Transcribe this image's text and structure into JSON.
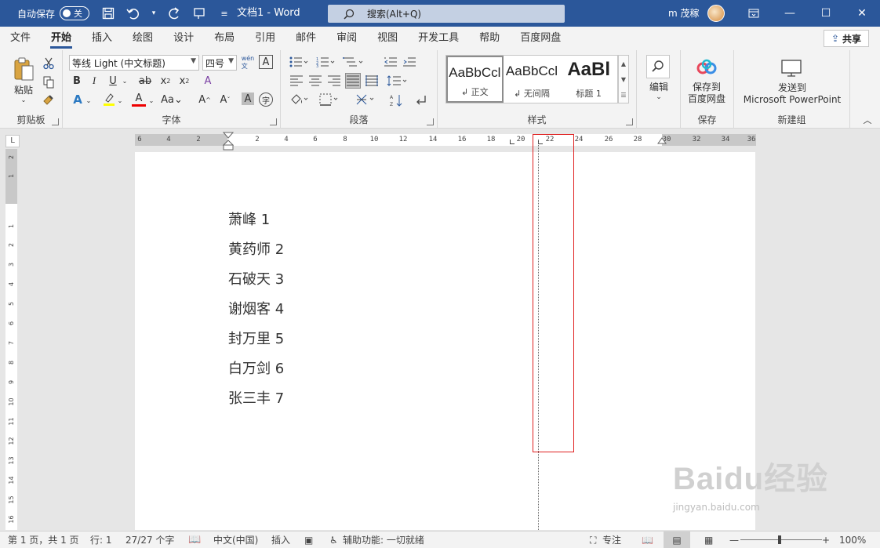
{
  "titlebar": {
    "autosave_label": "自动保存",
    "autosave_state": "关",
    "doc_title": "文档1  -  Word",
    "search_placeholder": "搜索(Alt+Q)",
    "user_name": "m 茂稼",
    "qat_icons": [
      "save-icon",
      "undo-icon",
      "redo-icon",
      "touch-mode-icon",
      "customize-icon"
    ]
  },
  "tabs": [
    "文件",
    "开始",
    "插入",
    "绘图",
    "设计",
    "布局",
    "引用",
    "邮件",
    "审阅",
    "视图",
    "开发工具",
    "帮助",
    "百度网盘"
  ],
  "active_tab": "开始",
  "share_label": "共享",
  "ribbon": {
    "clipboard": {
      "label": "剪贴板",
      "paste": "粘贴"
    },
    "font": {
      "label": "字体",
      "font_name": "等线 Light (中文标题)",
      "font_size": "四号"
    },
    "paragraph": {
      "label": "段落"
    },
    "styles": {
      "label": "样式",
      "items": [
        {
          "preview": "AaBbCcl",
          "name": "↲ 正文"
        },
        {
          "preview": "AaBbCcl",
          "name": "↲ 无间隔"
        },
        {
          "preview": "AaBl",
          "name": "标题 1"
        }
      ]
    },
    "editing": {
      "label": "编辑"
    },
    "baidu": {
      "group_label": "保存",
      "button": "保存到\n百度网盘"
    },
    "newgroup": {
      "group_label": "新建组",
      "button": "发送到\nMicrosoft PowerPoint"
    }
  },
  "ruler": {
    "h_ticks": [
      "6",
      "4",
      "2",
      "",
      "2",
      "4",
      "6",
      "8",
      "10",
      "12",
      "14",
      "16",
      "18",
      "20",
      "22",
      "24",
      "26",
      "28",
      "30",
      "32",
      "34",
      "36"
    ],
    "v_ticks": [
      "2",
      "1",
      "",
      "1",
      "2",
      "3",
      "4",
      "5",
      "6",
      "7",
      "8",
      "9",
      "10",
      "11",
      "12",
      "13",
      "14",
      "15",
      "16"
    ]
  },
  "document": {
    "lines": [
      "萧峰 1",
      "黄药师 2",
      "石破天 3",
      "谢烟客 4",
      "封万里 5",
      "白万剑 6",
      "张三丰 7"
    ]
  },
  "watermark": {
    "brand": "Baidu经验",
    "url": "jingyan.baidu.com"
  },
  "statusbar": {
    "page": "第 1 页，共 1 页",
    "line": "行: 1",
    "words": "27/27 个字",
    "language": "中文(中国)",
    "insert": "插入",
    "accessibility": "辅助功能: 一切就绪",
    "focus": "专注",
    "zoom": "100%"
  }
}
